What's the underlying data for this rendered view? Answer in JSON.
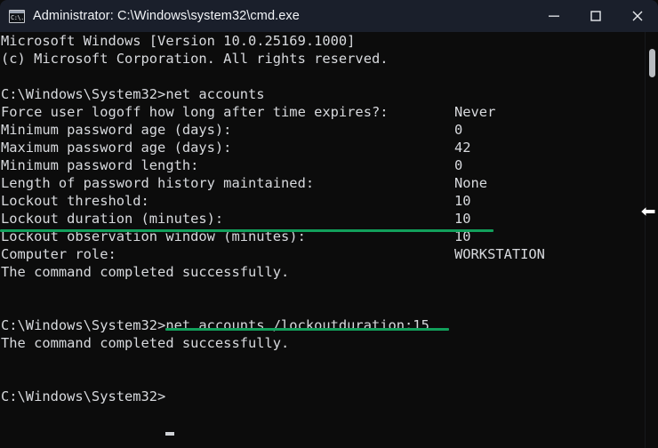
{
  "window": {
    "title": "Administrator: C:\\Windows\\system32\\cmd.exe",
    "icon": "cmd-console-icon",
    "icon_glyph": "C:\\.",
    "background_color": "#0c0c0c",
    "titlebar_color": "#1a1f2b",
    "text_color": "#d8dade",
    "controls": {
      "minimize_label": "Minimize",
      "maximize_label": "Maximize",
      "close_label": "Close"
    }
  },
  "annotation": {
    "color": "#12a05c",
    "underline_1_target": "Lockout duration (minutes):  10",
    "underline_2_target": "net accounts /lockoutduration:15"
  },
  "console": {
    "lines": [
      {
        "text": "Microsoft Windows [Version 10.0.25169.1000]",
        "value": ""
      },
      {
        "text": "(c) Microsoft Corporation. All rights reserved.",
        "value": ""
      },
      {
        "text": "",
        "value": ""
      },
      {
        "text": "C:\\Windows\\System32>net accounts",
        "value": ""
      },
      {
        "text": "Force user logoff how long after time expires?:",
        "value": "Never"
      },
      {
        "text": "Minimum password age (days):",
        "value": "0"
      },
      {
        "text": "Maximum password age (days):",
        "value": "42"
      },
      {
        "text": "Minimum password length:",
        "value": "0"
      },
      {
        "text": "Length of password history maintained:",
        "value": "None"
      },
      {
        "text": "Lockout threshold:",
        "value": "10"
      },
      {
        "text": "Lockout duration (minutes):",
        "value": "10"
      },
      {
        "text": "Lockout observation window (minutes):",
        "value": "10"
      },
      {
        "text": "Computer role:",
        "value": "WORKSTATION"
      },
      {
        "text": "The command completed successfully.",
        "value": ""
      },
      {
        "text": "",
        "value": ""
      },
      {
        "text": "",
        "value": ""
      },
      {
        "text": "C:\\Windows\\System32>net accounts /lockoutduration:15",
        "value": ""
      },
      {
        "text": "The command completed successfully.",
        "value": ""
      },
      {
        "text": "",
        "value": ""
      },
      {
        "text": "",
        "value": ""
      },
      {
        "text": "C:\\Windows\\System32>",
        "value": ""
      }
    ]
  },
  "scrollbar": {
    "name": "vertical-scrollbar",
    "thumb_position": "top"
  },
  "pointer": {
    "name": "mouse-pointer-left-arrow"
  }
}
